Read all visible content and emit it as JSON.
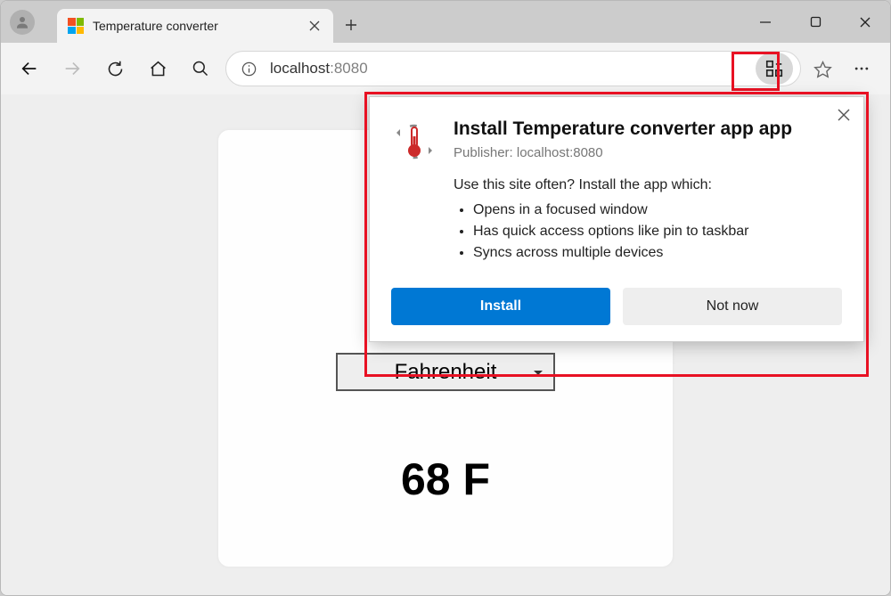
{
  "tab": {
    "title": "Temperature converter"
  },
  "address": {
    "host": "localhost",
    "port": ":8080"
  },
  "page": {
    "input_value": "",
    "select_value": "Fahrenheit",
    "result": "68 F"
  },
  "popup": {
    "title": "Install Temperature converter app app",
    "publisher": "Publisher: localhost:8080",
    "lead": "Use this site often? Install the app which:",
    "bullets": [
      "Opens in a focused window",
      "Has quick access options like pin to taskbar",
      "Syncs across multiple devices"
    ],
    "install_label": "Install",
    "notnow_label": "Not now"
  }
}
